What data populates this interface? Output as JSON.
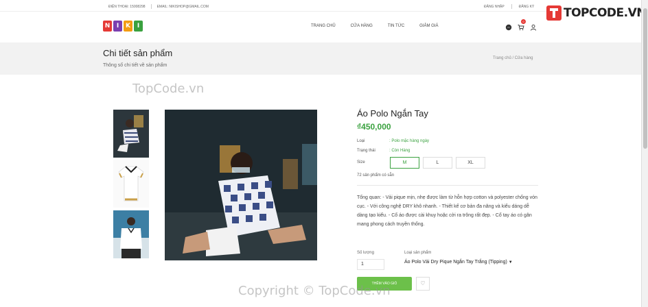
{
  "topbar": {
    "phone": "ĐIỆN THOẠI: 15008298",
    "email": "EMAIL: NIKISHOP@GMAIL.COM",
    "login": "ĐĂNG NHẬP",
    "register": "ĐĂNG KÝ"
  },
  "logo": {
    "letters": [
      "N",
      "I",
      "K",
      "I"
    ],
    "colors": [
      "#e53935",
      "#7b3fb0",
      "#f39c12",
      "#3aa13f"
    ]
  },
  "nav": [
    "TRANG CHỦ",
    "CỬA HÀNG",
    "TIN TỨC",
    "GIẢM GIÁ"
  ],
  "header_icons": {
    "cart_count": "0"
  },
  "brand": {
    "name": "TOPCODE",
    "tld": ".VN"
  },
  "banner": {
    "title": "Chi tiết sản phẩm",
    "subtitle": "Thông số chi tiết về sản phẩm",
    "breadcrumb": "Trang chủ  /  Cửa hàng"
  },
  "watermarks": {
    "top": "TopCode.vn",
    "bottom": "Copyright © TopCode.vn"
  },
  "product": {
    "name": "Áo Polo Ngắn Tay",
    "price": "₫450,000",
    "type_label": "Loại",
    "type_value": ": Polo mặc hàng ngày",
    "status_label": "Trạng thái",
    "status_value": ": Còn Hàng",
    "size_label": "Size",
    "sizes": [
      "M",
      "L",
      "XL"
    ],
    "selected_size": "M",
    "stock": "72 sản phẩm có sẵn",
    "description": "Tổng quan: - Vải pique mịn, nhẹ được làm từ hỗn hợp cotton và polyester chống vón cục. - Với công nghệ DRY khô nhanh. - Thiết kế cơ bản đa năng và kiểu dáng dễ dàng tạo kiểu. - Cổ áo được cài khuy hoặc cởi ra trông rất đẹp. - Cổ tay áo có gân mang phong cách truyền thống.",
    "qty_label": "Số lượng",
    "qty_value": "1",
    "variant_label": "Loại sản phẩm",
    "variant_value": "Áo Polo Vải Dry Pique Ngắn Tay Trắng (Tipping)",
    "add_to_cart": "THÊM VÀO GIỎ"
  }
}
